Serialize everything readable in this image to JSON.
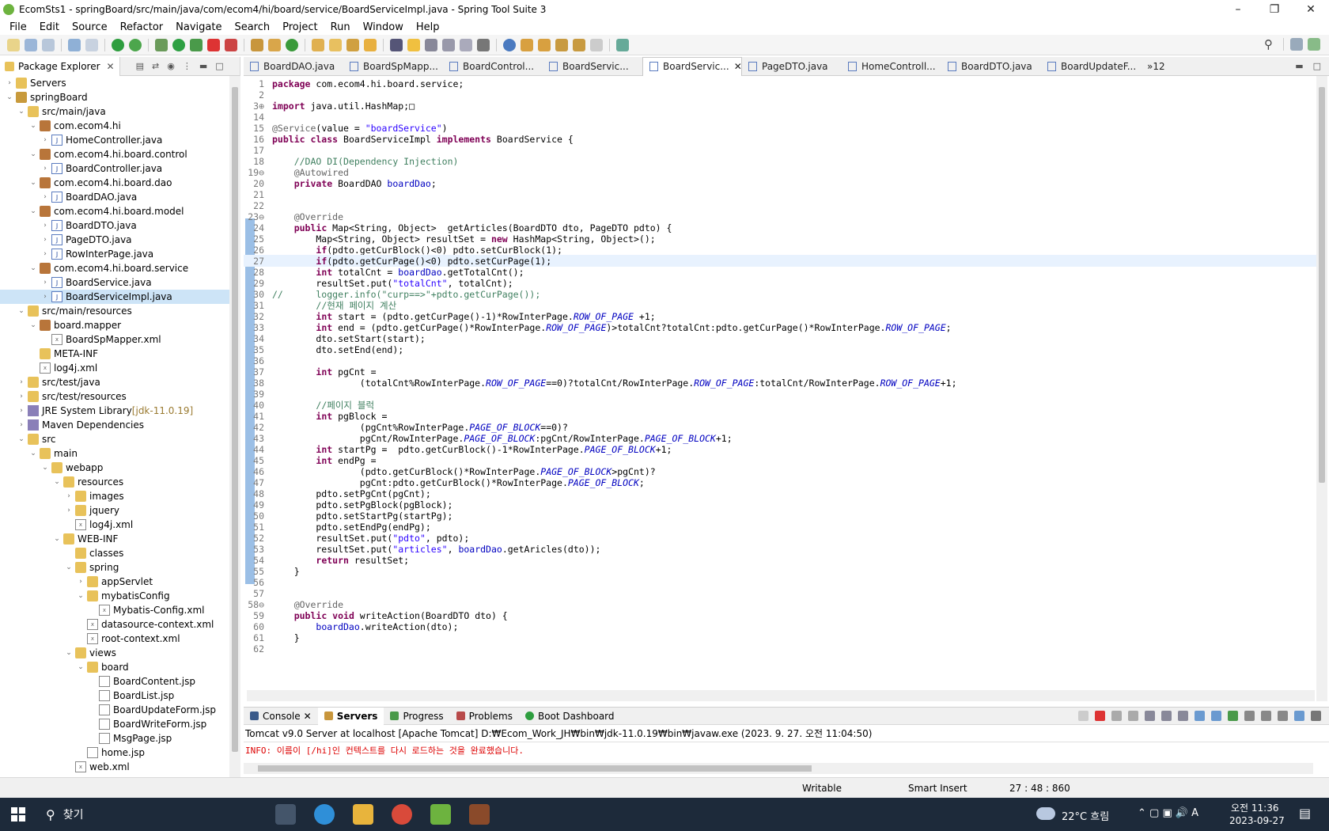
{
  "window": {
    "title": "EcomSts1 - springBoard/src/main/java/com/ecom4/hi/board/service/BoardServiceImpl.java - Spring Tool Suite 3"
  },
  "menu": [
    "File",
    "Edit",
    "Source",
    "Refactor",
    "Navigate",
    "Search",
    "Project",
    "Run",
    "Window",
    "Help"
  ],
  "package_explorer": {
    "tab_label": "Package Explorer",
    "tree": [
      {
        "indent": 0,
        "tw": "›",
        "icon": "fld",
        "label": "Servers"
      },
      {
        "indent": 0,
        "tw": "⌄",
        "icon": "prj",
        "label": "springBoard"
      },
      {
        "indent": 1,
        "tw": "⌄",
        "icon": "fld",
        "label": "src/main/java"
      },
      {
        "indent": 2,
        "tw": "⌄",
        "icon": "pkg",
        "label": "com.ecom4.hi"
      },
      {
        "indent": 3,
        "tw": "›",
        "icon": "jav",
        "label": "HomeController.java"
      },
      {
        "indent": 2,
        "tw": "⌄",
        "icon": "pkg",
        "label": "com.ecom4.hi.board.control"
      },
      {
        "indent": 3,
        "tw": "›",
        "icon": "jav",
        "label": "BoardController.java"
      },
      {
        "indent": 2,
        "tw": "⌄",
        "icon": "pkg",
        "label": "com.ecom4.hi.board.dao"
      },
      {
        "indent": 3,
        "tw": "›",
        "icon": "jav",
        "label": "BoardDAO.java"
      },
      {
        "indent": 2,
        "tw": "⌄",
        "icon": "pkg",
        "label": "com.ecom4.hi.board.model"
      },
      {
        "indent": 3,
        "tw": "›",
        "icon": "jav",
        "label": "BoardDTO.java"
      },
      {
        "indent": 3,
        "tw": "›",
        "icon": "jav",
        "label": "PageDTO.java"
      },
      {
        "indent": 3,
        "tw": "›",
        "icon": "jav",
        "label": "RowInterPage.java"
      },
      {
        "indent": 2,
        "tw": "⌄",
        "icon": "pkg",
        "label": "com.ecom4.hi.board.service"
      },
      {
        "indent": 3,
        "tw": "›",
        "icon": "jav",
        "label": "BoardService.java"
      },
      {
        "indent": 3,
        "tw": "›",
        "icon": "jav",
        "label": "BoardServiceImpl.java",
        "selected": true
      },
      {
        "indent": 1,
        "tw": "⌄",
        "icon": "fld",
        "label": "src/main/resources"
      },
      {
        "indent": 2,
        "tw": "⌄",
        "icon": "pkg",
        "label": "board.mapper"
      },
      {
        "indent": 3,
        "tw": "",
        "icon": "xml",
        "label": "BoardSpMapper.xml"
      },
      {
        "indent": 2,
        "tw": "",
        "icon": "fld",
        "label": "META-INF"
      },
      {
        "indent": 2,
        "tw": "",
        "icon": "xml",
        "label": "log4j.xml"
      },
      {
        "indent": 1,
        "tw": "›",
        "icon": "fld",
        "label": "src/test/java"
      },
      {
        "indent": 1,
        "tw": "›",
        "icon": "fld",
        "label": "src/test/resources"
      },
      {
        "indent": 1,
        "tw": "›",
        "icon": "lib",
        "label": "JRE System Library",
        "decor": "[jdk-11.0.19]"
      },
      {
        "indent": 1,
        "tw": "›",
        "icon": "lib",
        "label": "Maven Dependencies"
      },
      {
        "indent": 1,
        "tw": "⌄",
        "icon": "fld",
        "label": "src"
      },
      {
        "indent": 2,
        "tw": "⌄",
        "icon": "fld",
        "label": "main"
      },
      {
        "indent": 3,
        "tw": "⌄",
        "icon": "fld",
        "label": "webapp"
      },
      {
        "indent": 4,
        "tw": "⌄",
        "icon": "fld",
        "label": "resources"
      },
      {
        "indent": 5,
        "tw": "›",
        "icon": "fld",
        "label": "images"
      },
      {
        "indent": 5,
        "tw": "›",
        "icon": "fld",
        "label": "jquery"
      },
      {
        "indent": 5,
        "tw": "",
        "icon": "xml",
        "label": "log4j.xml"
      },
      {
        "indent": 4,
        "tw": "⌄",
        "icon": "fld",
        "label": "WEB-INF"
      },
      {
        "indent": 5,
        "tw": "",
        "icon": "fld",
        "label": "classes"
      },
      {
        "indent": 5,
        "tw": "⌄",
        "icon": "fld",
        "label": "spring"
      },
      {
        "indent": 6,
        "tw": "›",
        "icon": "fld",
        "label": "appServlet"
      },
      {
        "indent": 6,
        "tw": "⌄",
        "icon": "fld",
        "label": "mybatisConfig"
      },
      {
        "indent": 7,
        "tw": "",
        "icon": "xml",
        "label": "Mybatis-Config.xml"
      },
      {
        "indent": 6,
        "tw": "",
        "icon": "xml",
        "label": "datasource-context.xml"
      },
      {
        "indent": 6,
        "tw": "",
        "icon": "xml",
        "label": "root-context.xml"
      },
      {
        "indent": 5,
        "tw": "⌄",
        "icon": "fld",
        "label": "views"
      },
      {
        "indent": 6,
        "tw": "⌄",
        "icon": "fld",
        "label": "board"
      },
      {
        "indent": 7,
        "tw": "",
        "icon": "jsp",
        "label": "BoardContent.jsp"
      },
      {
        "indent": 7,
        "tw": "",
        "icon": "jsp",
        "label": "BoardList.jsp"
      },
      {
        "indent": 7,
        "tw": "",
        "icon": "jsp",
        "label": "BoardUpdateForm.jsp"
      },
      {
        "indent": 7,
        "tw": "",
        "icon": "jsp",
        "label": "BoardWriteForm.jsp"
      },
      {
        "indent": 7,
        "tw": "",
        "icon": "jsp",
        "label": "MsgPage.jsp"
      },
      {
        "indent": 6,
        "tw": "",
        "icon": "jsp",
        "label": "home.jsp"
      },
      {
        "indent": 5,
        "tw": "",
        "icon": "xml",
        "label": "web.xml"
      }
    ]
  },
  "editor": {
    "tabs": [
      "BoardDAO.java",
      "BoardSpMapp...",
      "BoardControl...",
      "BoardServic...",
      "BoardServic...",
      "PageDTO.java",
      "HomeControll...",
      "BoardDTO.java",
      "BoardUpdateF..."
    ],
    "active_tab": 4,
    "overflow": "»12",
    "lines": [
      {
        "n": "1",
        "html": "<span class='kw'>package</span> com.ecom4.hi.board.service;"
      },
      {
        "n": "2",
        "html": ""
      },
      {
        "n": "3⊕",
        "html": "<span class='kw'>import</span> java.util.HashMap;□"
      },
      {
        "n": "14",
        "html": ""
      },
      {
        "n": "15",
        "html": "<span class='an'>@Service</span>(value = <span class='str'>\"boardService\"</span>)"
      },
      {
        "n": "16",
        "html": "<span class='kw'>public class</span> BoardServiceImpl <span class='kw'>implements</span> BoardService {"
      },
      {
        "n": "17",
        "html": ""
      },
      {
        "n": "18",
        "html": "    <span class='cm'>//DAO DI(Dependency Injection)</span>"
      },
      {
        "n": "19⊖",
        "html": "    <span class='an'>@Autowired</span>"
      },
      {
        "n": "20",
        "html": "    <span class='kw'>private</span> BoardDAO <span class='fld'>boardDao</span>;"
      },
      {
        "n": "21",
        "html": ""
      },
      {
        "n": "22",
        "html": ""
      },
      {
        "n": "23⊖",
        "html": "    <span class='an'>@Override</span>"
      },
      {
        "n": "24",
        "html": "    <span class='kw'>public</span> Map&lt;String, Object&gt;  getArticles(BoardDTO dto, PageDTO pdto) {"
      },
      {
        "n": "25",
        "html": "        Map&lt;String, Object&gt; resultSet = <span class='kw'>new</span> HashMap&lt;String, Object&gt;();"
      },
      {
        "n": "26",
        "html": "        <span class='kw'>if</span>(pdto.getCurBlock()&lt;0) pdto.setCurBlock(1);"
      },
      {
        "n": "27",
        "html": "        <span class='kw'>if</span>(pdto.getCurPage()&lt;0) pdto.setCurPage(1);",
        "cur": true
      },
      {
        "n": "28",
        "html": "        <span class='kw'>int</span> totalCnt = <span class='fld'>boardDao</span>.getTotalCnt();"
      },
      {
        "n": "29",
        "html": "        resultSet.put(<span class='str'>\"totalCnt\"</span>, totalCnt);"
      },
      {
        "n": "30",
        "html": "<span class='cm'>//      logger.info(\"curp==>\"+pdto.getCurPage());</span>"
      },
      {
        "n": "31",
        "html": "        <span class='cm'>//현재 페이지 계산</span>"
      },
      {
        "n": "32",
        "html": "        <span class='kw'>int</span> start = (pdto.getCurPage()-1)*RowInterPage.<span class='sf'>ROW_OF_PAGE</span> +1;"
      },
      {
        "n": "33",
        "html": "        <span class='kw'>int</span> end = (pdto.getCurPage()*RowInterPage.<span class='sf'>ROW_OF_PAGE</span>)&gt;totalCnt?totalCnt:pdto.getCurPage()*RowInterPage.<span class='sf'>ROW_OF_PAGE</span>;"
      },
      {
        "n": "34",
        "html": "        dto.setStart(start);"
      },
      {
        "n": "35",
        "html": "        dto.setEnd(end);"
      },
      {
        "n": "36",
        "html": ""
      },
      {
        "n": "37",
        "html": "        <span class='kw'>int</span> pgCnt ="
      },
      {
        "n": "38",
        "html": "                (totalCnt%RowInterPage.<span class='sf'>ROW_OF_PAGE</span>==0)?totalCnt/RowInterPage.<span class='sf'>ROW_OF_PAGE</span>:totalCnt/RowInterPage.<span class='sf'>ROW_OF_PAGE</span>+1;"
      },
      {
        "n": "39",
        "html": ""
      },
      {
        "n": "40",
        "html": "        <span class='cm'>//페이지 블럭</span>"
      },
      {
        "n": "41",
        "html": "        <span class='kw'>int</span> pgBlock ="
      },
      {
        "n": "42",
        "html": "                (pgCnt%RowInterPage.<span class='sf'>PAGE_OF_BLOCK</span>==0)?"
      },
      {
        "n": "43",
        "html": "                pgCnt/RowInterPage.<span class='sf'>PAGE_OF_BLOCK</span>:pgCnt/RowInterPage.<span class='sf'>PAGE_OF_BLOCK</span>+1;"
      },
      {
        "n": "44",
        "html": "        <span class='kw'>int</span> startPg =  pdto.getCurBlock()-1*RowInterPage.<span class='sf'>PAGE_OF_BLOCK</span>+1;"
      },
      {
        "n": "45",
        "html": "        <span class='kw'>int</span> endPg ="
      },
      {
        "n": "46",
        "html": "                (pdto.getCurBlock()*RowInterPage.<span class='sf'>PAGE_OF_BLOCK</span>&gt;pgCnt)?"
      },
      {
        "n": "47",
        "html": "                pgCnt:pdto.getCurBlock()*RowInterPage.<span class='sf'>PAGE_OF_BLOCK</span>;"
      },
      {
        "n": "48",
        "html": "        pdto.setPgCnt(pgCnt);"
      },
      {
        "n": "49",
        "html": "        pdto.setPgBlock(pgBlock);"
      },
      {
        "n": "50",
        "html": "        pdto.setStartPg(startPg);"
      },
      {
        "n": "51",
        "html": "        pdto.setEndPg(endPg);"
      },
      {
        "n": "52",
        "html": "        resultSet.put(<span class='str'>\"pdto\"</span>, pdto);"
      },
      {
        "n": "53",
        "html": "        resultSet.put(<span class='str'>\"articles\"</span>, <span class='fld'>boardDao</span>.getAricles(dto));"
      },
      {
        "n": "54",
        "html": "        <span class='kw'>return</span> resultSet;"
      },
      {
        "n": "55",
        "html": "    }"
      },
      {
        "n": "56",
        "html": ""
      },
      {
        "n": "57",
        "html": ""
      },
      {
        "n": "58⊖",
        "html": "    <span class='an'>@Override</span>"
      },
      {
        "n": "59",
        "html": "    <span class='kw'>public void</span> writeAction(BoardDTO dto) {"
      },
      {
        "n": "60",
        "html": "        <span class='fld'>boardDao</span>.writeAction(dto);"
      },
      {
        "n": "61",
        "html": "    }"
      },
      {
        "n": "62",
        "html": ""
      }
    ]
  },
  "bottom": {
    "tabs": [
      "Console",
      "Servers",
      "Progress",
      "Problems",
      "Boot Dashboard"
    ],
    "server_line": "Tomcat v9.0 Server at localhost [Apache Tomcat] D:₩Ecom_Work_JH₩bin₩jdk-11.0.19₩bin₩javaw.exe  (2023. 9. 27. 오전 11:04:50)",
    "log_line": "INFO: 이름이 [/hi]인 컨텍스트를 다시 로드하는 것을 완료했습니다."
  },
  "status": {
    "writable": "Writable",
    "insert": "Smart Insert",
    "position": "27 : 48 : 860"
  },
  "taskbar": {
    "search": "찾기",
    "weather": "22°C  흐림",
    "time": "오전 11:36",
    "date": "2023-09-27"
  }
}
